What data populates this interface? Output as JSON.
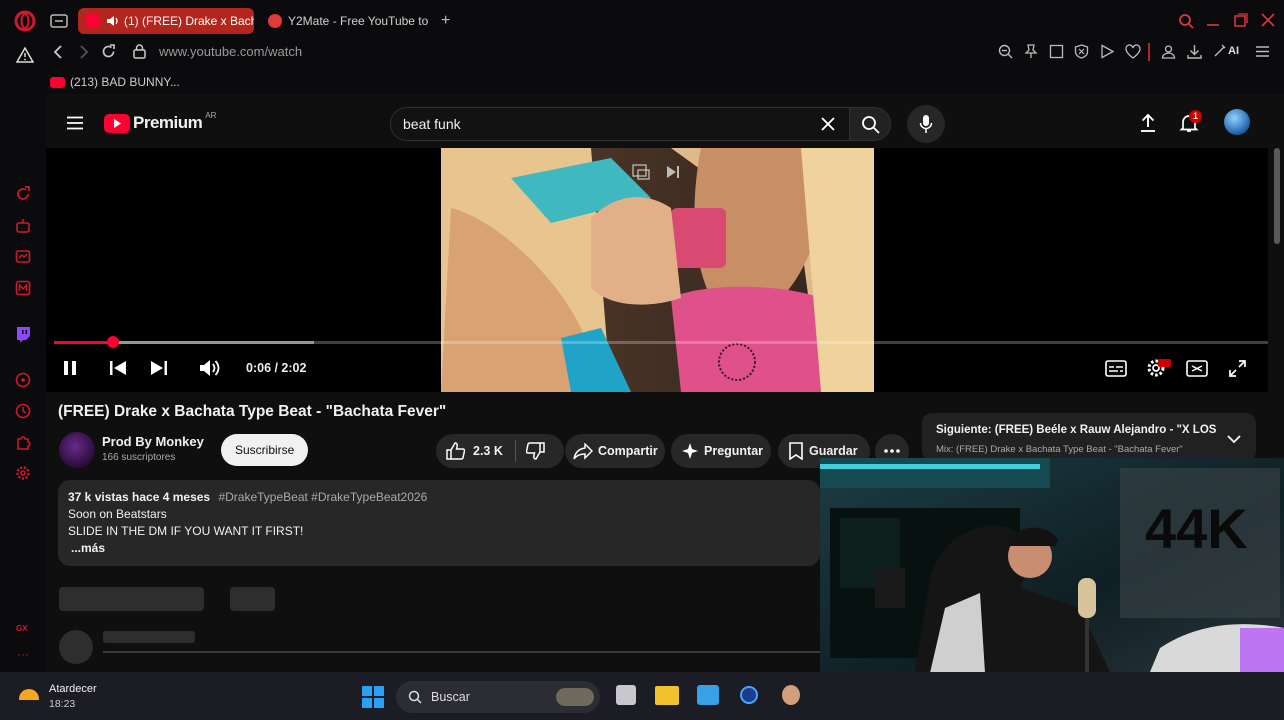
{
  "browser": {
    "tabs": [
      {
        "label": "(1) (FREE) Drake x Bach",
        "active": true
      },
      {
        "label": "Y2Mate - Free YouTube to",
        "active": false
      }
    ],
    "url": "www.youtube.com/watch",
    "ai_label": "AI",
    "bookmark": "(213) BAD BUNNY...",
    "colors": {
      "accent": "#b3261e",
      "brand": "#ff0033"
    }
  },
  "youtube": {
    "logo_text": "Premium",
    "logo_region": "AR",
    "search_value": "beat funk",
    "notification_count": "1",
    "player": {
      "time": "0:06 / 2:02",
      "progress": 0.049,
      "buffered": 0.214
    },
    "video": {
      "title": "(FREE) Drake x Bachata Type Beat - \"Bachata Fever\"",
      "channel": "Prod By Monkey",
      "subscribers": "166 suscriptores",
      "subscribe_label": "Suscribirse",
      "likes": "2.3 K",
      "share_label": "Compartir",
      "ask_label": "Preguntar",
      "save_label": "Guardar"
    },
    "description": {
      "meta": "37 k vistas  hace 4 meses",
      "tags": "#DrakeTypeBeat #DrakeTypeBeat2026",
      "line1": "Soon on Beatstars",
      "line2": "SLIDE IN THE DM IF YOU WANT IT FIRST!",
      "more": "...más"
    },
    "next": {
      "title": "Siguiente: (FREE) Beéle x Rauw Alejandro - \"X LOS...",
      "subtitle": "Mix: (FREE) Drake x Bachata Type Beat - \"Bachata Fever\""
    }
  },
  "webcam": {
    "wall_text": "44K"
  },
  "taskbar": {
    "weather_label": "Atardecer",
    "time": "18:23",
    "search_placeholder": "Buscar"
  }
}
